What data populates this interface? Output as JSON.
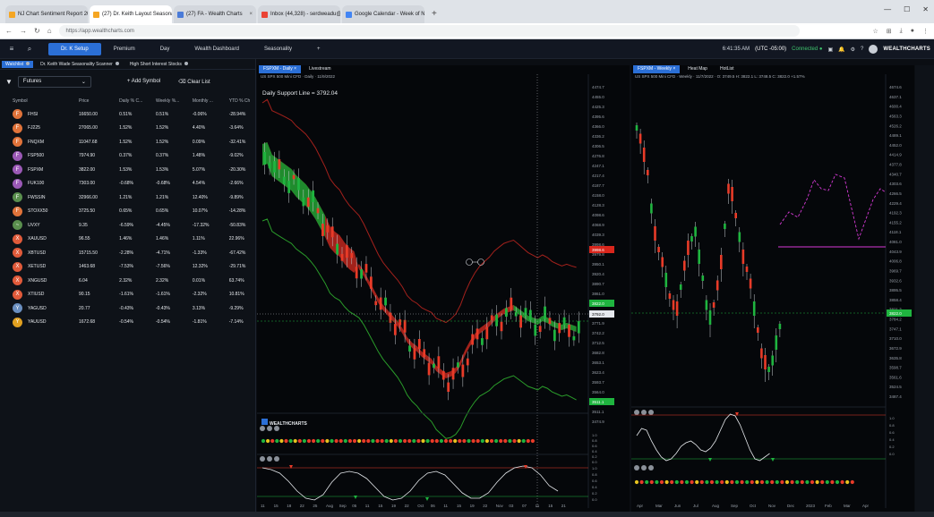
{
  "browser": {
    "tabs": [
      {
        "label": "NJ Chart Sentiment Report 202",
        "fav": "#f5a623",
        "active": false
      },
      {
        "label": "(27) Dr. Keith Layout Seasonal",
        "fav": "#f5a623",
        "active": true
      },
      {
        "label": "(27) FA - Wealth Charts",
        "fav": "#4a7bd8",
        "active": false
      },
      {
        "label": "Inbox (44,328) - serdweadu@a",
        "fav": "#ea4335",
        "active": false
      },
      {
        "label": "Google Calendar - Week of No",
        "fav": "#4285f4",
        "active": false
      }
    ],
    "url": "https://app.wealthcharts.com"
  },
  "header": {
    "tabs": [
      {
        "label": "Dr. K Setup",
        "active": true
      },
      {
        "label": "Premium",
        "active": false
      },
      {
        "label": "Day",
        "active": false
      },
      {
        "label": "Wealth Dashboard",
        "active": false
      },
      {
        "label": "Seasonality",
        "active": false
      }
    ],
    "add_label": "+",
    "time": "6:41:35 AM",
    "tz": "(UTC -05:00)",
    "status": "Connected",
    "logo": "WEALTHCHARTS"
  },
  "watchlist": {
    "subtabs": [
      {
        "label": "Watchlist",
        "active": true
      },
      {
        "label": "Dr. Keith Wade Seasonality Scanner",
        "active": false
      },
      {
        "label": "High Short Interest Stocks",
        "active": false
      }
    ],
    "filter": "Futures",
    "add_symbol": "+ Add Symbol",
    "clear_list": "Clear List",
    "columns": [
      "Symbol",
      "Price",
      "Daily % C...",
      "Weekly %...",
      "Monthly ...",
      "YTD % Ch"
    ],
    "rows": [
      {
        "icon": "F",
        "color": "#e0733a",
        "symbol": "FHSI",
        "price": "16650.00",
        "d": "0.51%",
        "w": "0.51%",
        "m": "-0.06%",
        "y": "-28.94%"
      },
      {
        "icon": "F",
        "color": "#e0733a",
        "symbol": "FJ225",
        "price": "27065.00",
        "d": "1.52%",
        "w": "1.52%",
        "m": "4.40%",
        "y": "-3.64%"
      },
      {
        "icon": "F",
        "color": "#e0733a",
        "symbol": "FNQXM",
        "price": "11047.68",
        "d": "1.52%",
        "w": "1.52%",
        "m": "0.09%",
        "y": "-32.41%"
      },
      {
        "icon": "F",
        "color": "#9b59b6",
        "symbol": "FSP500",
        "price": "7974.90",
        "d": "0.37%",
        "w": "0.37%",
        "m": "1.48%",
        "y": "-9.02%"
      },
      {
        "icon": "F",
        "color": "#9b59b6",
        "symbol": "FSPXM",
        "price": "3822.00",
        "d": "1.53%",
        "w": "1.53%",
        "m": "5.07%",
        "y": "-20.30%"
      },
      {
        "icon": "F",
        "color": "#9b59b6",
        "symbol": "FUK100",
        "price": "7303.00",
        "d": "-0.68%",
        "w": "-0.68%",
        "m": "4.54%",
        "y": "-2.66%"
      },
      {
        "icon": "F",
        "color": "#5a8f4e",
        "symbol": "FWSSIN",
        "price": "32966.00",
        "d": "1.21%",
        "w": "1.21%",
        "m": "12.40%",
        "y": "-9.89%"
      },
      {
        "icon": "F",
        "color": "#e0733a",
        "symbol": "STOXX50",
        "price": "3725.50",
        "d": "0.65%",
        "w": "0.65%",
        "m": "10.07%",
        "y": "-14.28%"
      },
      {
        "icon": "~",
        "color": "#5a8f4e",
        "symbol": "UVXY",
        "price": "9.35",
        "d": "-6.59%",
        "w": "-4.45%",
        "m": "-17.32%",
        "y": "-50.83%"
      },
      {
        "icon": "X",
        "color": "#e05a3a",
        "symbol": "XAUUSD",
        "price": "96.55",
        "d": "1.46%",
        "w": "1.46%",
        "m": "1.11%",
        "y": "22.96%"
      },
      {
        "icon": "X",
        "color": "#e05a3a",
        "symbol": "XBTUSD",
        "price": "15715.50",
        "d": "-2.28%",
        "w": "-4.71%",
        "m": "-1.33%",
        "y": "-67.42%"
      },
      {
        "icon": "X",
        "color": "#e05a3a",
        "symbol": "XETUSD",
        "price": "1463.68",
        "d": "-7.53%",
        "w": "-7.56%",
        "m": "12.32%",
        "y": "-29.71%"
      },
      {
        "icon": "X",
        "color": "#e05a3a",
        "symbol": "XNGUSD",
        "price": "6.04",
        "d": "2.32%",
        "w": "2.32%",
        "m": "0.01%",
        "y": "63.74%"
      },
      {
        "icon": "X",
        "color": "#e05a3a",
        "symbol": "XTIUSD",
        "price": "90.15",
        "d": "-1.61%",
        "w": "-1.61%",
        "m": "-2.32%",
        "y": "10.81%"
      },
      {
        "icon": "Y",
        "color": "#6a8fc0",
        "symbol": "YAGUSD",
        "price": "20.77",
        "d": "-0.43%",
        "w": "-0.43%",
        "m": "3.13%",
        "y": "-9.29%"
      },
      {
        "icon": "Y",
        "color": "#e0a020",
        "symbol": "YAUUSD",
        "price": "1672.68",
        "d": "-0.54%",
        "w": "-0.54%",
        "m": "-1.81%",
        "y": "-7.14%"
      }
    ]
  },
  "daily_chart": {
    "tabs": [
      {
        "label": "FSPXM - Daily",
        "active": true
      },
      {
        "label": "Livestream",
        "active": false
      }
    ],
    "info": "US SPX 500 Mini CFD · Daily · 11/9/2022",
    "support": "Daily Support Line = 3792.04",
    "price_labels": [
      "4474.7",
      "4455.0",
      "4425.3",
      "4395.6",
      "4366.0",
      "4336.2",
      "4306.5",
      "4276.8",
      "4247.1",
      "4217.4",
      "4187.7",
      "4158.0",
      "4128.3",
      "4098.6",
      "4068.9",
      "4039.3",
      "3998.6",
      "3979.8",
      "3950.1",
      "3920.4",
      "3890.7",
      "3861.0",
      "3831.3",
      "3801.6",
      "3771.9",
      "3742.2",
      "3712.5",
      "3682.8",
      "3653.1",
      "3623.4",
      "3593.7",
      "3564.0",
      "3534.3",
      "3511.1",
      "3474.9"
    ],
    "date_labels": [
      "11",
      "15",
      "18",
      "22",
      "25",
      "Aug",
      "Sep",
      "05",
      "11",
      "15",
      "19",
      "22",
      "Oct",
      "06",
      "11",
      "15",
      "19",
      "22",
      "Nov",
      "03",
      "07",
      "11",
      "15",
      "21"
    ],
    "watermark": "WEALTHCHARTS",
    "last_price": "3822.0",
    "crosshair_price": "3792.0",
    "low_label": "3511.1",
    "red_tag": "3998.6"
  },
  "weekly_chart": {
    "tabs": [
      {
        "label": "FSPXM - Weekly",
        "active": true
      },
      {
        "label": "Heat Map",
        "active": false
      },
      {
        "label": "HotList",
        "active": false
      }
    ],
    "info": "US SPX 500 Mini CFD · Weekly · 11/7/2022 · O: 3749.5 H: 3822.1 L: 3748.5 C: 3822.0 +1.57%",
    "price_labels": [
      "4674.6",
      "4637.1",
      "4600.4",
      "4563.3",
      "4526.2",
      "4489.1",
      "4452.0",
      "4414.9",
      "4377.8",
      "4340.7",
      "4303.6",
      "4266.5",
      "4229.4",
      "4192.3",
      "4155.2",
      "4118.1",
      "4081.0",
      "4043.9",
      "4006.8",
      "3969.7",
      "3932.6",
      "3895.5",
      "3858.4",
      "3821.3",
      "3784.2",
      "3747.1",
      "3710.0",
      "3672.9",
      "3635.8",
      "3598.7",
      "3561.6",
      "3524.5",
      "3487.4"
    ],
    "date_labels": [
      "Apr",
      "Mar",
      "Jun",
      "Jul",
      "Aug",
      "Sep",
      "Oct",
      "Nov",
      "Dec",
      "2023",
      "Feb",
      "Mar",
      "Apr"
    ],
    "last_price": "3822.0"
  },
  "osc_labels": [
    "1.0",
    "0.8",
    "0.6",
    "0.4",
    "0.2",
    "0.0"
  ],
  "colors": {
    "accent": "#2b6fd6",
    "up": "#2ec26d",
    "down": "#f04438"
  }
}
